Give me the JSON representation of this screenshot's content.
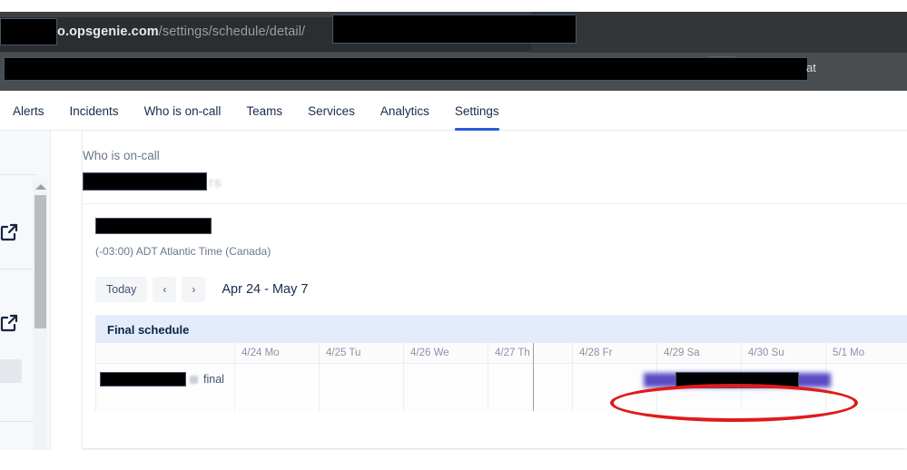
{
  "browser": {
    "url_redacted_prefix": "",
    "url_host_suffix": "o.opsgenie.com",
    "url_path": "/settings/schedule/detail/",
    "bookmark_text": "at"
  },
  "nav": {
    "items": [
      {
        "label": "Alerts",
        "active": false
      },
      {
        "label": "Incidents",
        "active": false
      },
      {
        "label": "Who is on-call",
        "active": false
      },
      {
        "label": "Teams",
        "active": false
      },
      {
        "label": "Services",
        "active": false
      },
      {
        "label": "Analytics",
        "active": false
      },
      {
        "label": "Settings",
        "active": true
      }
    ],
    "accent_color": "#2a5bd7"
  },
  "page": {
    "breadcrumb": "Who is on-call",
    "title_ghost": "rs",
    "timezone": "(-03:00) ADT Atlantic Time (Canada)"
  },
  "toolbar": {
    "today_label": "Today",
    "prev_label": "‹",
    "next_label": "›",
    "range_label": "Apr 24 - May 7"
  },
  "schedule": {
    "section_title": "Final schedule",
    "section_bg": "#e4ecfb",
    "row_label": "final",
    "days": [
      "4/24 Mo",
      "4/25 Tu",
      "4/26 We",
      "4/27 Th",
      "4/28 Fr",
      "4/29 Sa",
      "4/30 Su",
      "5/1 Mo"
    ],
    "rotation_color": "#5b4bc4",
    "now_marker_color": "#b09a86"
  },
  "annotation": {
    "shape": "ellipse",
    "color": "#e01b1b"
  }
}
